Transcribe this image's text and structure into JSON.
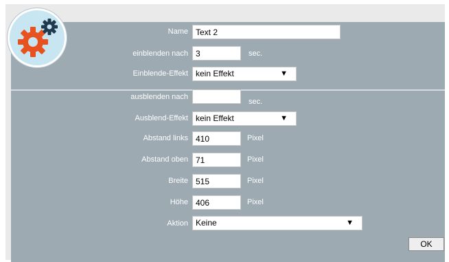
{
  "icon": "gears-icon",
  "colors": {
    "panel": "#9eaab2",
    "frame": "#eaeaea",
    "gear_large": "#e8521e",
    "gear_small": "#1f3a4d",
    "badge_bg": "#c8e5f2"
  },
  "fields": {
    "name": {
      "label": "Name",
      "value": "Text 2"
    },
    "fade_in_after": {
      "label": "einblenden nach",
      "value": "3",
      "unit": "sec."
    },
    "fade_in_effect": {
      "label": "Einblende-Effekt",
      "value": "kein Effekt",
      "arrow": "▼"
    },
    "fade_out_after": {
      "label": "ausblenden nach",
      "value": "",
      "unit": "sec."
    },
    "fade_out_effect": {
      "label": "Ausblend-Effekt",
      "value": "kein Effekt",
      "arrow": "▼"
    },
    "left_distance": {
      "label": "Abstand links",
      "value": "410",
      "unit": "Pixel"
    },
    "top_distance": {
      "label": "Abstand oben",
      "value": "71",
      "unit": "Pixel"
    },
    "width": {
      "label": "Breite",
      "value": "515",
      "unit": "Pixel"
    },
    "height": {
      "label": "Höhe",
      "value": "406",
      "unit": "Pixel"
    },
    "action": {
      "label": "Aktion",
      "value": "Keine",
      "arrow": "▼"
    }
  },
  "ok_label": "OK"
}
